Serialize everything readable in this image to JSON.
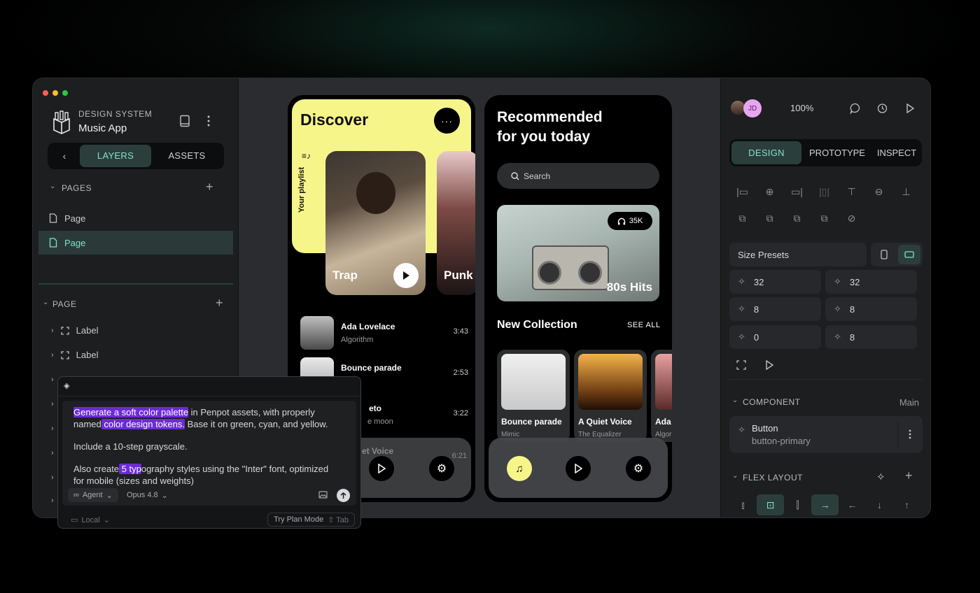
{
  "window": {
    "traffic_colors": [
      "#ff5f57",
      "#febc2e",
      "#28c840"
    ]
  },
  "sidebar": {
    "project_label": "DESIGN SYSTEM",
    "project_name": "Music App",
    "tabs": {
      "layers": "LAYERS",
      "assets": "ASSETS"
    },
    "pages_header": "PAGES",
    "pages": [
      {
        "label": "Page"
      },
      {
        "label": "Page"
      }
    ],
    "page_header": "PAGE",
    "layers": [
      {
        "label": "Label"
      },
      {
        "label": "Label"
      }
    ]
  },
  "chat": {
    "prompt_line1_hl": "Generate a soft color palette",
    "prompt_line1_rest": " in Penpot assets,  with properly",
    "prompt_line2_pre": "named",
    "prompt_line2_hl": " color design tokens.",
    "prompt_line2_rest": " Base it on green, cyan, and yellow.",
    "prompt_line3": "Include a 10-step grayscale.",
    "prompt_line4_pre": "Also create",
    "prompt_line4_hl": " 5 typ",
    "prompt_line4_rest": "ography styles using the \"Inter\" font, optimized",
    "prompt_line5": "for mobile (sizes and weights)",
    "mode": "Agent",
    "model": "Opus 4.8",
    "env": "Local",
    "plan_hint": "Try Plan Mode",
    "plan_key": "⇧ Tab"
  },
  "phone1": {
    "title": "Discover",
    "playlist_label": "Your playlist",
    "card1": "Trap",
    "card2": "Punk",
    "tracks": [
      {
        "title": "Ada Lovelace",
        "artist": "Algorithm",
        "time": "3:43"
      },
      {
        "title": "Bounce parade",
        "artist": "",
        "time": "2:53"
      },
      {
        "title": "eto",
        "artist": "e moon",
        "time": "3:22"
      },
      {
        "title": "et Voice",
        "artist": "",
        "time": "6:21"
      }
    ]
  },
  "phone2": {
    "title_line1": "Recommended",
    "title_line2": "for you today",
    "search_placeholder": "Search",
    "hero_badge": "35K",
    "hero_title": "80s Hits",
    "section_title": "New Collection",
    "see_all": "SEE ALL",
    "albums": [
      {
        "title": "Bounce parade",
        "artist": "Mimic"
      },
      {
        "title": "A Quiet Voice",
        "artist": "The Equalizer"
      },
      {
        "title": "Ada",
        "artist": "Algor"
      }
    ]
  },
  "inspector": {
    "avatar_initials": "JD",
    "zoom": "100%",
    "tabs": {
      "design": "DESIGN",
      "prototype": "PROTOTYPE",
      "inspect": "INSPECT"
    },
    "size_presets": "Size Presets",
    "fields": [
      "32",
      "32",
      "8",
      "8",
      "0",
      "8"
    ],
    "component_header": "COMPONENT",
    "component_main": "Main",
    "component_name": "Button",
    "component_variant": "button-primary",
    "flex_header": "FLEX LAYOUT"
  },
  "colors": {
    "accent": "#7fe3cf",
    "yellow": "#f6f58a",
    "highlight": "#6c2bd9"
  }
}
